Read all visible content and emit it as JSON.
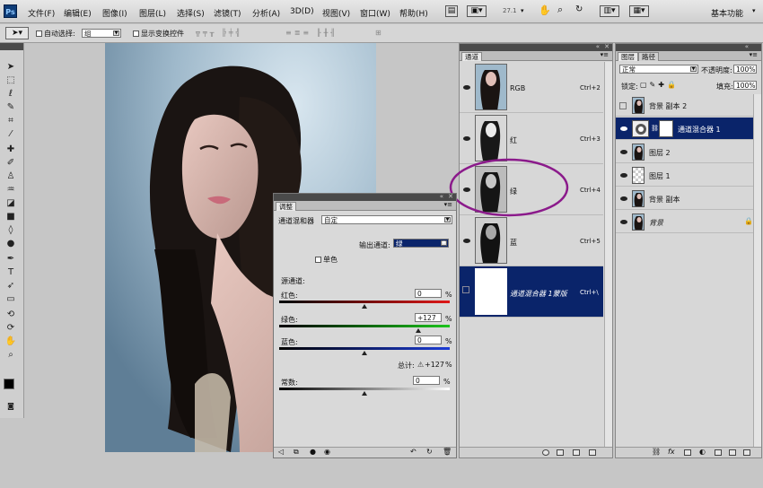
{
  "menubar": {
    "logo": "Ps",
    "items": [
      "文件(F)",
      "编辑(E)",
      "图像(I)",
      "图层(L)",
      "选择(S)",
      "滤镜(T)",
      "分析(A)",
      "3D(D)",
      "视图(V)",
      "窗口(W)",
      "帮助(H)"
    ],
    "zoom": "27.1",
    "workspace": "基本功能"
  },
  "options": {
    "auto_select": "自动选择:",
    "auto_select_value": "组",
    "show_transform": "显示变换控件"
  },
  "channels_panel": {
    "tab": "通道",
    "rows": [
      {
        "name": "RGB",
        "shortcut": "Ctrl+2"
      },
      {
        "name": "红",
        "shortcut": "Ctrl+3"
      },
      {
        "name": "绿",
        "shortcut": "Ctrl+4"
      },
      {
        "name": "蓝",
        "shortcut": "Ctrl+5"
      },
      {
        "name": "通道混合器 1蒙版",
        "shortcut": "Ctrl+\\"
      }
    ]
  },
  "adjust_panel": {
    "tab": "调整",
    "title": "通道混和器",
    "preset": "自定",
    "output_label": "输出通道:",
    "output_value": "绿",
    "mono_label": "单色",
    "source_label": "源通道:",
    "red_label": "红色:",
    "red_value": "0",
    "green_label": "绿色:",
    "green_value": "+127",
    "blue_label": "蓝色:",
    "blue_value": "0",
    "total_label": "总计:",
    "total_value": "+127",
    "pct": "%",
    "const_label": "常数:",
    "const_value": "0",
    "sliders": {
      "red": 0,
      "green": 127,
      "blue": 0,
      "constant": 0
    }
  },
  "layers_panel": {
    "tabs": [
      "图层",
      "路径"
    ],
    "blend_mode": "正常",
    "opacity_label": "不透明度:",
    "opacity_value": "100%",
    "lock_label": "锁定:",
    "fill_label": "填充:",
    "fill_value": "100%",
    "layers": [
      {
        "name": "背景 副本 2"
      },
      {
        "name": "通道混合器 1"
      },
      {
        "name": "图层 2"
      },
      {
        "name": "图层 1"
      },
      {
        "name": "背景 副本"
      },
      {
        "name": "背景"
      }
    ]
  },
  "colors": {
    "highlight": "#0a246a",
    "annotation": "#8b1a8b"
  }
}
